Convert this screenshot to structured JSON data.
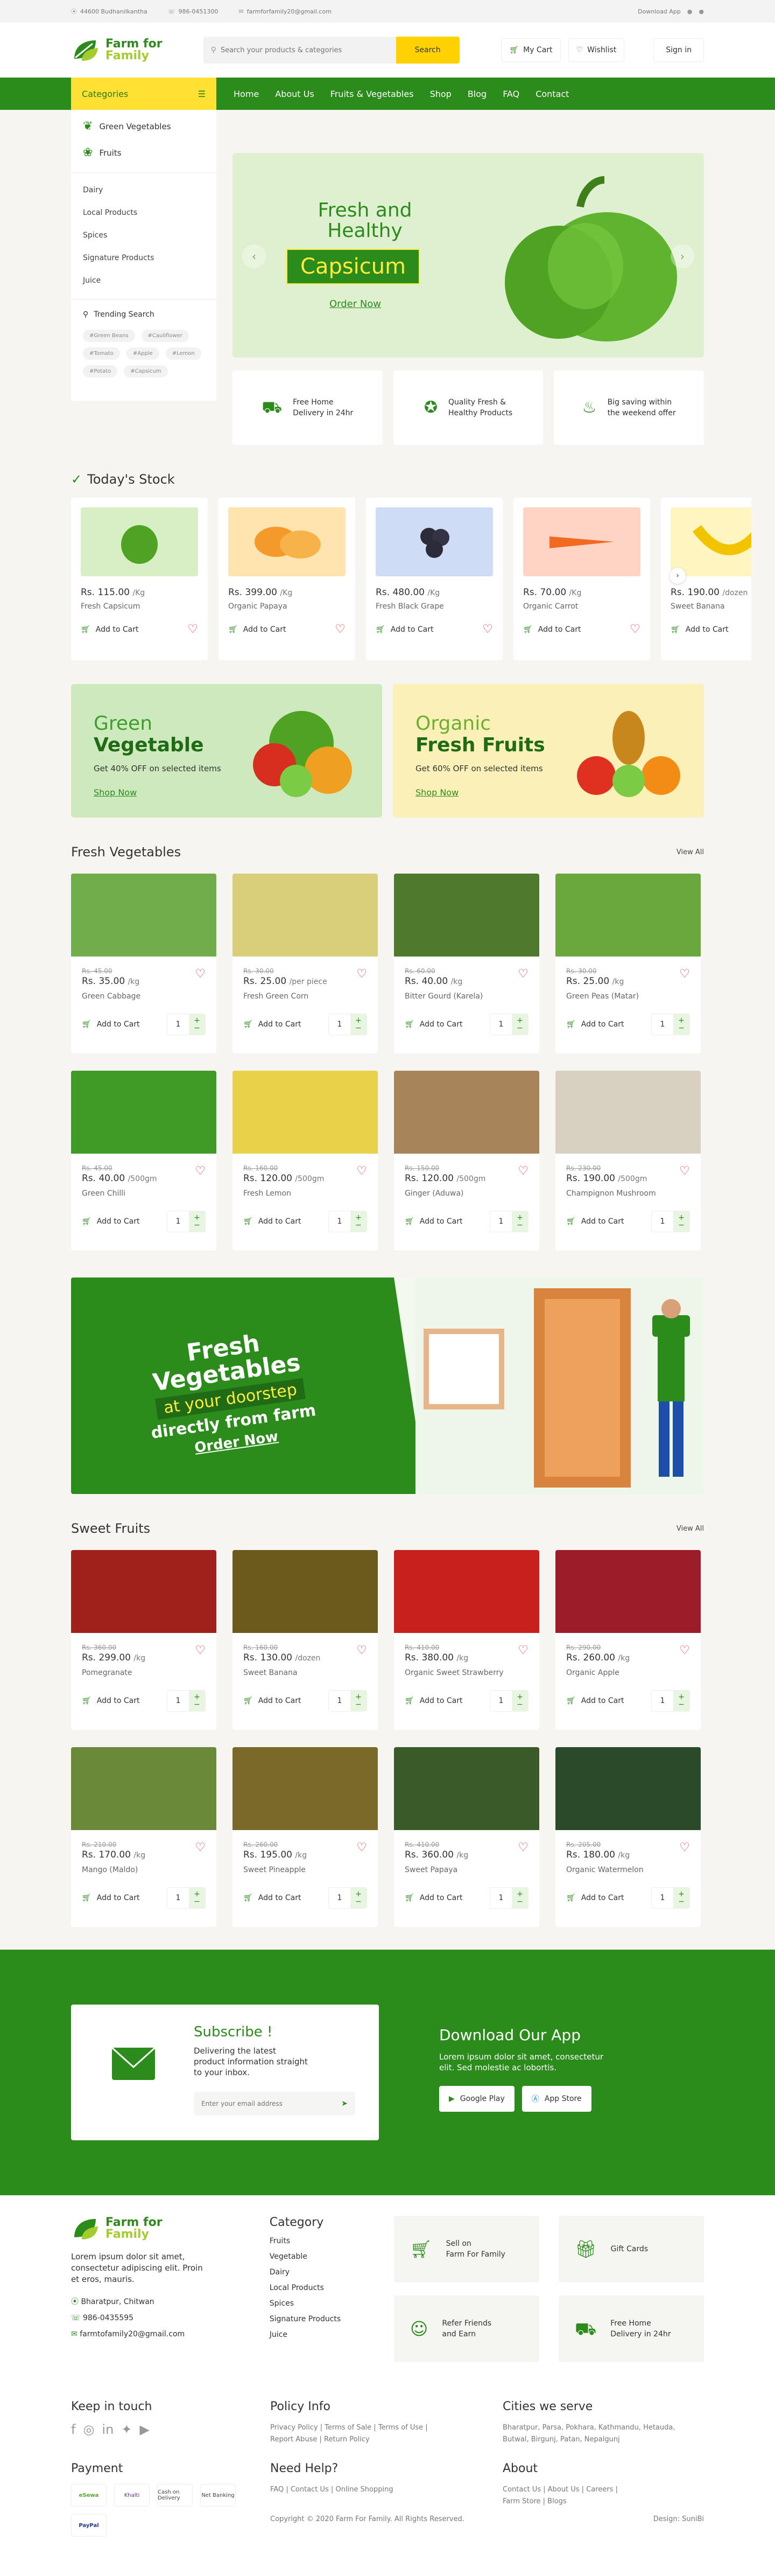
{
  "topbar": {
    "address": "44600 Budhanilkantha",
    "phone": "986-0451300",
    "email": "farmforfamily20@gmail.com",
    "download": "Download App"
  },
  "logo": {
    "line1": "Farm for",
    "line2": "Family"
  },
  "search": {
    "placeholder": "Search your products & categories",
    "button": "Search"
  },
  "header": {
    "cart": "My Cart",
    "wishlist": "Wishlist",
    "signin": "Sign in"
  },
  "nav": {
    "categories": "Categories",
    "items": [
      "Home",
      "About Us",
      "Fruits & Vegetables",
      "Shop",
      "Blog",
      "FAQ",
      "Contact"
    ]
  },
  "sidebar": {
    "main": [
      "Green Vegetables",
      "Fruits"
    ],
    "sub": [
      "Dairy",
      "Local Products",
      "Spices",
      "Signature Products",
      "Juice"
    ],
    "trending_title": "Trending Search",
    "tags": [
      "#Green Beans",
      "#Cauliflower",
      "#Tomato",
      "#Apple",
      "#Lemon",
      "#Potato",
      "#Capsicum"
    ]
  },
  "hero": {
    "line1": "Fresh and",
    "line2": "Healthy",
    "highlight": "Capsicum",
    "cta": "Order Now"
  },
  "features": [
    {
      "line1": "Free Home",
      "line2": "Delivery in 24hr"
    },
    {
      "line1": "Quality Fresh &",
      "line2": "Healthy Products"
    },
    {
      "line1": "Big saving within",
      "line2": "the weekend offer"
    }
  ],
  "stock": {
    "title": "Today's Stock",
    "add": "Add to Cart",
    "items": [
      {
        "price": "Rs. 115.00",
        "unit": "/Kg",
        "name": "Fresh Capsicum"
      },
      {
        "price": "Rs. 399.00",
        "unit": "/Kg",
        "name": "Organic Papaya"
      },
      {
        "price": "Rs. 480.00",
        "unit": "/Kg",
        "name": "Fresh Black Grape"
      },
      {
        "price": "Rs. 70.00",
        "unit": "/Kg",
        "name": "Organic Carrot"
      },
      {
        "price": "Rs. 190.00",
        "unit": "/dozen",
        "name": "Sweet Banana"
      }
    ]
  },
  "promos": [
    {
      "a": "Green",
      "b": "Vegetable",
      "c": "Get 40% OFF on selected items",
      "d": "Shop Now"
    },
    {
      "a": "Organic",
      "b": "Fresh Fruits",
      "c": "Get 60% OFF on selected items",
      "d": "Shop Now"
    }
  ],
  "veg": {
    "title": "Fresh Vegetables",
    "viewall": "View All",
    "add": "Add to Cart",
    "qty": "1",
    "items": [
      {
        "old": "Rs. 45.00",
        "price": "Rs. 35.00",
        "unit": "/kg",
        "name": "Green Cabbage"
      },
      {
        "old": "Rs. 30.00",
        "price": "Rs. 25.00",
        "unit": "/per piece",
        "name": "Fresh Green Corn"
      },
      {
        "old": "Rs. 60.00",
        "price": "Rs. 40.00",
        "unit": "/kg",
        "name": "Bitter Gourd (Karela)"
      },
      {
        "old": "Rs. 30.00",
        "price": "Rs. 25.00",
        "unit": "/kg",
        "name": "Green Peas (Matar)"
      },
      {
        "old": "Rs. 45.00",
        "price": "Rs. 40.00",
        "unit": "/500gm",
        "name": "Green Chilli"
      },
      {
        "old": "Rs. 160.00",
        "price": "Rs. 120.00",
        "unit": "/500gm",
        "name": "Fresh Lemon"
      },
      {
        "old": "Rs. 150.00",
        "price": "Rs. 120.00",
        "unit": "/500gm",
        "name": "Ginger (Aduwa)"
      },
      {
        "old": "Rs. 230.00",
        "price": "Rs. 190.00",
        "unit": "/500gm",
        "name": "Champignon Mushroom"
      }
    ]
  },
  "banner": {
    "l1": "Fresh",
    "l2": "Vegetables",
    "l3": "at your doorstep",
    "l4": "directly from farm",
    "l5": "Order Now"
  },
  "fruits": {
    "title": "Sweet Fruits",
    "viewall": "View All",
    "add": "Add to Cart",
    "qty": "1",
    "items": [
      {
        "old": "Rs. 360.00",
        "price": "Rs. 299.00",
        "unit": "/kg",
        "name": "Pomegranate"
      },
      {
        "old": "Rs. 160.00",
        "price": "Rs. 130.00",
        "unit": "/dozen",
        "name": "Sweet Banana"
      },
      {
        "old": "Rs. 410.00",
        "price": "Rs. 380.00",
        "unit": "/kg",
        "name": "Organic Sweet Strawberry"
      },
      {
        "old": "Rs. 290.00",
        "price": "Rs. 260.00",
        "unit": "/kg",
        "name": "Organic Apple"
      },
      {
        "old": "Rs. 210.00",
        "price": "Rs. 170.00",
        "unit": "/kg",
        "name": "Mango (Maldo)"
      },
      {
        "old": "Rs. 260.00",
        "price": "Rs. 195.00",
        "unit": "/kg",
        "name": "Sweet Pineapple"
      },
      {
        "old": "Rs. 410.00",
        "price": "Rs. 360.00",
        "unit": "/kg",
        "name": "Sweet Papaya"
      },
      {
        "old": "Rs. 205.00",
        "price": "Rs. 180.00",
        "unit": "/kg",
        "name": "Organic Watermelon"
      }
    ]
  },
  "subscribe": {
    "title": "Subscribe !",
    "desc1": "Delivering the latest",
    "desc2": "product information straight",
    "desc3": "to your inbox.",
    "placeholder": "Enter your email address"
  },
  "app": {
    "title": "Download Our App",
    "desc1": "Lorem ipsum dolor sit amet, consectetur",
    "desc2": "elit. Sed molestie ac lobortis.",
    "gplay": "Google Play",
    "appstore": "App Store"
  },
  "footer": {
    "about1": "Lorem ipsum dolor sit amet,",
    "about2": "consectetur adipiscing elit. Proin",
    "about3": "et eros, mauris.",
    "address": "Bharatpur, Chitwan",
    "phone": "986-0435595",
    "email": "farmtofamily20@gmail.com",
    "category_title": "Category",
    "categories": [
      "Fruits",
      "Vegetable",
      "Dairy",
      "Local Products",
      "Spices",
      "Signature Products",
      "Juice"
    ],
    "boxes": [
      {
        "l1": "Sell on",
        "l2": "Farm For Family"
      },
      {
        "l1": "Gift Cards",
        "l2": ""
      },
      {
        "l1": "Refer Friends",
        "l2": "and Earn"
      },
      {
        "l1": "Free Home",
        "l2": "Delivery in 24hr"
      }
    ],
    "keep": "Keep in touch",
    "policy_title": "Policy Info",
    "policy1": "Privacy Policy | Terms of Sale | Terms of Use |",
    "policy2": "Report Abuse | Return Policy",
    "cities_title": "Cities we serve",
    "cities1": "Bharatpur, Parsa, Pokhara, Kathmandu, Hetauda,",
    "cities2": "Butwal, Birgunj, Patan, Nepalgunj",
    "payment": "Payment",
    "help_title": "Need Help?",
    "help": "FAQ | Contact Us | Online Shopping",
    "about_title": "About",
    "about_links1": "Contact Us | About Us | Careers |",
    "about_links2": "Farm Store | Blogs",
    "pay": [
      "eSewa",
      "Khalti",
      "Cash on Delivery",
      "Net Banking",
      "PayPal"
    ],
    "copy": "Copyright © 2020 Farm For Family. All Rights Reserved.",
    "design": "Design: SuniBi"
  }
}
